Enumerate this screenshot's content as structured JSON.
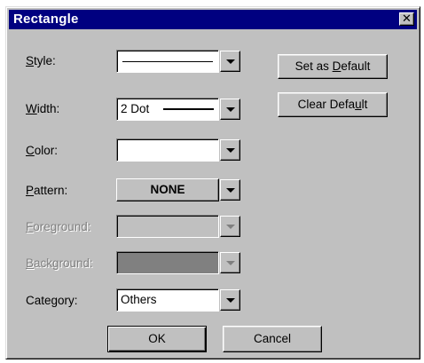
{
  "window": {
    "title": "Rectangle",
    "close_glyph": "✕"
  },
  "fields": {
    "style": {
      "label_pre": "",
      "label_u": "S",
      "label_post": "tyle:",
      "value": ""
    },
    "width": {
      "label_pre": "",
      "label_u": "W",
      "label_post": "idth:",
      "value": "2 Dot"
    },
    "color": {
      "label_pre": "",
      "label_u": "C",
      "label_post": "olor:",
      "value": ""
    },
    "pattern": {
      "label_pre": "",
      "label_u": "P",
      "label_post": "attern:",
      "value": "NONE"
    },
    "foreground": {
      "label_pre": "",
      "label_u": "F",
      "label_post": "oreground:",
      "value": ""
    },
    "background": {
      "label_pre": "",
      "label_u": "B",
      "label_post": "ackground:",
      "value": ""
    },
    "category": {
      "label": "Category:",
      "value": "Others"
    }
  },
  "buttons": {
    "set_default": {
      "pre": "Set as ",
      "u": "D",
      "post": "efault"
    },
    "clear_default": {
      "pre": "Clear Defa",
      "u": "u",
      "post": "lt"
    },
    "ok": "OK",
    "cancel": "Cancel"
  },
  "colors": {
    "title_bar": "#000080",
    "face": "#c0c0c0",
    "disabled_text": "#808080",
    "background_swatch": "#808080"
  }
}
